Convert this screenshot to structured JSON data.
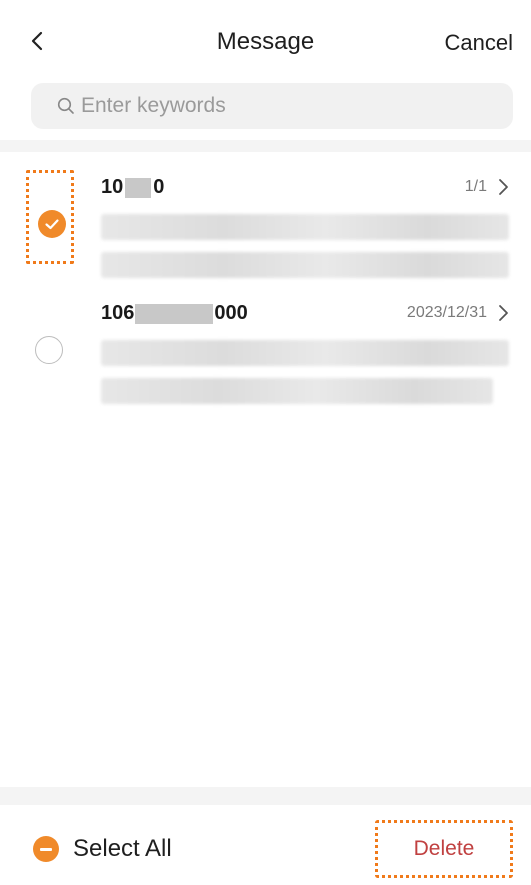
{
  "header": {
    "back_icon": "chevron-left-icon",
    "title": "Message",
    "cancel_label": "Cancel"
  },
  "search": {
    "icon": "search-icon",
    "placeholder": "Enter keywords",
    "value": ""
  },
  "messages": [
    {
      "sender_prefix": "10",
      "sender_suffix": "0",
      "meta": "1/1",
      "selected": true
    },
    {
      "sender_prefix": "106",
      "sender_suffix": "000",
      "meta": "2023/12/31",
      "selected": false
    }
  ],
  "footer": {
    "select_all_label": "Select All",
    "delete_label": "Delete"
  },
  "colors": {
    "accent": "#f08a2a",
    "highlight_border": "#f07a1a",
    "delete_text": "#c04040"
  }
}
